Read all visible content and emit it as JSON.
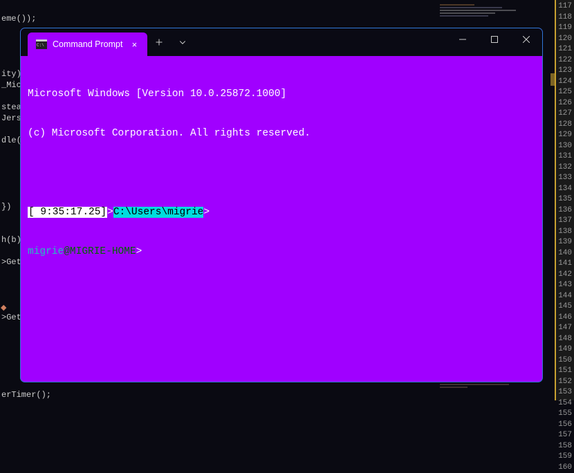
{
  "background": {
    "left_lines": [
      "",
      "eme());",
      "",
      "",
      "",
      "",
      "ity)",
      "_Mica(",
      "",
      "stead",
      "Jers",
      "",
      "dle(",
      "",
      "",
      "",
      "",
      "",
      "})",
      "",
      "",
      "h(b);",
      "",
      ">GetH",
      "",
      "",
      "",
      "",
      ">GetH",
      "",
      "",
      "",
      "",
      "",
      "",
      "erTimer();"
    ],
    "right_line_numbers_start": 117,
    "right_line_numbers_end": 160
  },
  "terminal": {
    "tab_title": "Command Prompt",
    "banner_line1": "Microsoft Windows [Version 10.0.25872.1000]",
    "banner_line2": "(c) Microsoft Corporation. All rights reserved.",
    "prompt1": {
      "timestamp": "[ 9:35:17.25]",
      "gt1": ">",
      "path": "C:\\Users\\migrie",
      "gt2": ">"
    },
    "prompt2": {
      "user": "migrie",
      "at": "@",
      "host": "MIGRIE-HOME",
      "gt": ">"
    }
  },
  "icons": {
    "close_tab": "×",
    "plus": "+",
    "chevron": "⌄"
  }
}
